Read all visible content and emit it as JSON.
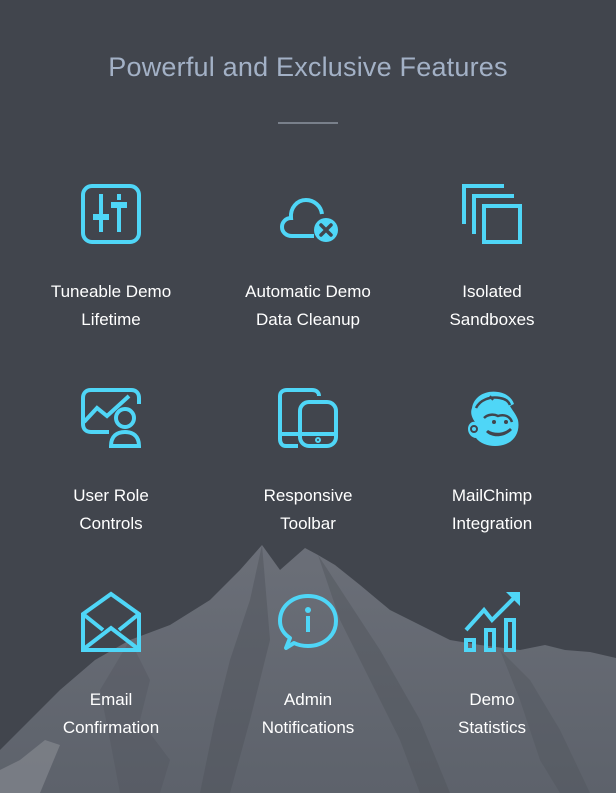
{
  "header": {
    "title": "Powerful and Exclusive Features"
  },
  "colors": {
    "background": "#41454d",
    "accent": "#4fd6f7",
    "title": "#a3b1c6",
    "label": "#ffffff"
  },
  "features": [
    {
      "icon": "sliders-icon",
      "line1": "Tuneable Demo",
      "line2": "Lifetime"
    },
    {
      "icon": "cloud-remove-icon",
      "line1": "Automatic Demo",
      "line2": "Data Cleanup"
    },
    {
      "icon": "stacked-squares-icon",
      "line1": "Isolated",
      "line2": "Sandboxes"
    },
    {
      "icon": "user-chart-icon",
      "line1": "User Role",
      "line2": "Controls"
    },
    {
      "icon": "tablet-phone-icon",
      "line1": "Responsive",
      "line2": "Toolbar"
    },
    {
      "icon": "mailchimp-icon",
      "line1": "MailChimp",
      "line2": "Integration"
    },
    {
      "icon": "open-envelope-icon",
      "line1": "Email",
      "line2": "Confirmation"
    },
    {
      "icon": "info-bubble-icon",
      "line1": "Admin",
      "line2": "Notifications"
    },
    {
      "icon": "growth-chart-icon",
      "line1": "Demo",
      "line2": "Statistics"
    }
  ]
}
